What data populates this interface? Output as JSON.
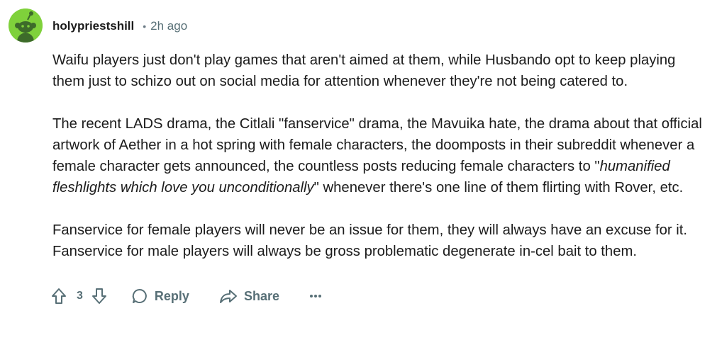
{
  "comment": {
    "author": "holypriestshill",
    "separator": "•",
    "timestamp": "2h ago",
    "avatar_color": "#7fd13b",
    "paragraphs": {
      "p1": "Waifu players just don't play games that aren't aimed at them, while Husbando opt to keep playing them just to schizo out on social media for attention whenever they're not being catered to.",
      "p2_before": "The recent LADS drama, the Citlali \"fanservice\" drama, the Mavuika hate, the drama about that official artwork of Aether in a hot spring with female characters, the doomposts in their subreddit whenever a female character gets announced, the countless posts reducing female characters to \"",
      "p2_italic": "humanified fleshlights which love you unconditionally",
      "p2_after": "\" whenever there's one line of them flirting with Rover, etc.",
      "p3": "Fanservice for female players will never be an issue for them, they will always have an excuse for it. Fanservice for male players will always be gross problematic degenerate in-cel bait to them."
    }
  },
  "actions": {
    "vote_count": "3",
    "reply_label": "Reply",
    "share_label": "Share",
    "more_label": "•••",
    "upvote_icon": "upvote-arrow-icon",
    "downvote_icon": "downvote-arrow-icon",
    "reply_icon": "speech-bubble-icon",
    "share_icon": "share-arrow-icon",
    "muted_color": "#576f76"
  }
}
